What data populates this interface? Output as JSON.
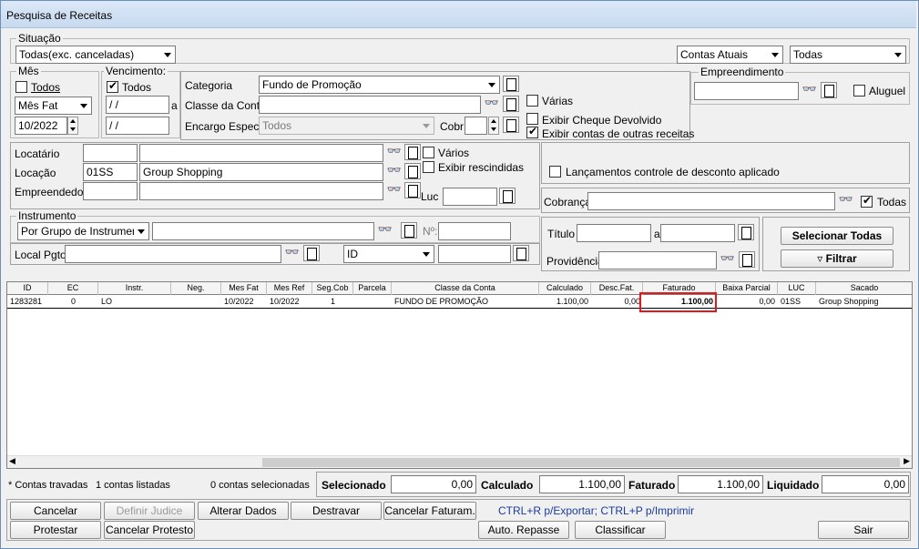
{
  "window": {
    "title": "Pesquisa de Receitas"
  },
  "situacao": {
    "legend": "Situação",
    "select": "Todas(exc. canceladas)",
    "contas": "Contas Atuais",
    "todas": "Todas"
  },
  "mes": {
    "legend": "Mês",
    "todos_label": "Todos",
    "todos_checked": false,
    "tipo": "Mês Fat",
    "valor": "10/2022"
  },
  "vencimento": {
    "legend": "Vencimento:",
    "todos_label": "Todos",
    "todos_checked": true,
    "de": " / /",
    "ate_label": "a",
    "ate": " / /"
  },
  "categoria": {
    "categoria_label": "Categoria",
    "categoria_value": "Fundo de Promoção",
    "classe_label": "Classe da Conta",
    "classe_value": "",
    "encargo_label": "Encargo Espec.",
    "encargo_value": "Todos",
    "cobr_label": "Cobr",
    "cobr_value": "",
    "varias_label": "Várias",
    "cheque_label": "Exibir Cheque Devolvido",
    "outras_label": "Exibir contas de outras receitas"
  },
  "empreendimento": {
    "legend": "Empreendimento",
    "value": "",
    "aluguel_label": "Aluguel"
  },
  "locatario": {
    "locatario_label": "Locatário",
    "locatario_code": "",
    "locatario_name": "",
    "locacao_label": "Locação",
    "locacao_code": "01SS",
    "locacao_name": "Group Shopping",
    "empreendedor_label": "Empreendedor",
    "empreendedor_code": "",
    "empreendedor_name": "",
    "varios_label": "Vários",
    "rescindidas_label": "Exibir rescindidas",
    "luc_label": "Luc",
    "luc_value": ""
  },
  "lancamentos": {
    "label": "Lançamentos controle de desconto aplicado"
  },
  "cobranca": {
    "label": "Cobrança",
    "value": "",
    "todas_label": "Todas"
  },
  "instrumento": {
    "legend": "Instrumento",
    "tipo": "Por Grupo de Instrumento",
    "value": "",
    "n_label": "Nº:",
    "n_value": ""
  },
  "localpgto": {
    "label": "Local Pgto",
    "value": "",
    "id_select": "ID",
    "id_value": ""
  },
  "titulo": {
    "label": "Título",
    "de": "",
    "a_label": "a",
    "ate": "",
    "providencia_label": "Providência",
    "providencia_value": ""
  },
  "actions": {
    "selecionar": "Selecionar Todas",
    "filtrar": "Filtrar"
  },
  "grid": {
    "columns": [
      "ID",
      "EC",
      "Instr.",
      "Neg.",
      "Mes Fat",
      "Mes Ref",
      "Seg.Cob",
      "Parcela",
      "Classe da Conta",
      "Calculado",
      "Desc.Fat.",
      "Faturado",
      "Baixa Parcial",
      "LUC",
      "Sacado"
    ],
    "rows": [
      {
        "id": "1283281",
        "ec": "0",
        "instr": "LO",
        "neg": "",
        "mes_fat": "10/2022",
        "mes_ref": "10/2022",
        "seg_cob": "1",
        "parcela": "",
        "classe": "FUNDO DE PROMOÇÃO",
        "calculado": "1.100,00",
        "desc_fat": "0,00",
        "faturado": "1.100,00",
        "baixa_parcial": "0,00",
        "luc": "01SS",
        "sacado": "Group Shopping"
      }
    ]
  },
  "status": {
    "travadas": "* Contas travadas",
    "listadas": "1 contas listadas",
    "selecionadas": "0 contas selecionadas",
    "selecionado_label": "Selecionado",
    "selecionado_value": "0,00",
    "calculado_label": "Calculado",
    "calculado_value": "1.100,00",
    "faturado_label": "Faturado",
    "faturado_value": "1.100,00",
    "liquidado_label": "Liquidado",
    "liquidado_value": "0,00"
  },
  "buttons": {
    "cancelar": "Cancelar",
    "definir_judice": "Definir Judice",
    "alterar_dados": "Alterar Dados",
    "destravar": "Destravar",
    "cancelar_faturam": "Cancelar Faturam.",
    "hint": "CTRL+R p/Exportar; CTRL+P p/Imprimir",
    "protestar": "Protestar",
    "cancelar_protesto": "Cancelar Protesto",
    "auto_repasse": "Auto. Repasse",
    "classificar": "Classificar",
    "sair": "Sair"
  },
  "colors": {
    "highlight": "#e8151b",
    "hint": "#1a3c9c"
  }
}
